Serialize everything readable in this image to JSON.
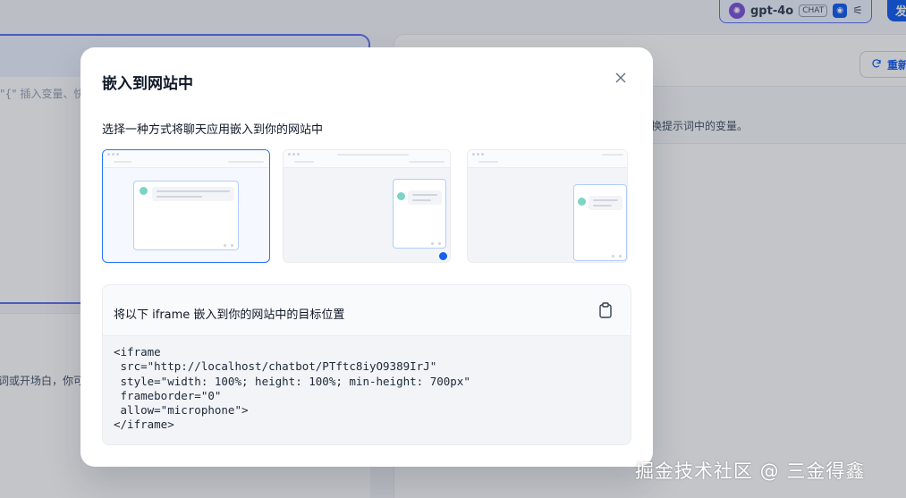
{
  "background": {
    "left_hint": "\"{\" 插入变量、快",
    "left_lower_text": "词或开场白，你可",
    "reset_label": "重新",
    "right_hint": "替换提示词中的变量。",
    "model_name": "gpt-4o",
    "chat_badge": "CHAT",
    "publish_label": "发"
  },
  "modal": {
    "title": "嵌入到网站中",
    "subtitle": "选择一种方式将聊天应用嵌入到你的网站中",
    "code_card": {
      "label": "将以下 iframe 嵌入到你的网站中的目标位置",
      "code_lines": [
        "<iframe",
        " src=\"http://localhost/chatbot/PTftc8iyO9389IrJ\"",
        " style=\"width: 100%; height: 100%; min-height: 700px\"",
        " frameborder=\"0\"",
        " allow=\"microphone\">",
        "</iframe>"
      ]
    }
  },
  "watermark": "掘金技术社区 @ 三金得鑫",
  "colors": {
    "accent": "#155eef",
    "selected_border": "#2970ff",
    "model_border": "#6172f3"
  },
  "icons": [
    "close-icon",
    "copy-icon",
    "refresh-icon",
    "openai-icon",
    "eye-icon",
    "sliders-icon"
  ]
}
